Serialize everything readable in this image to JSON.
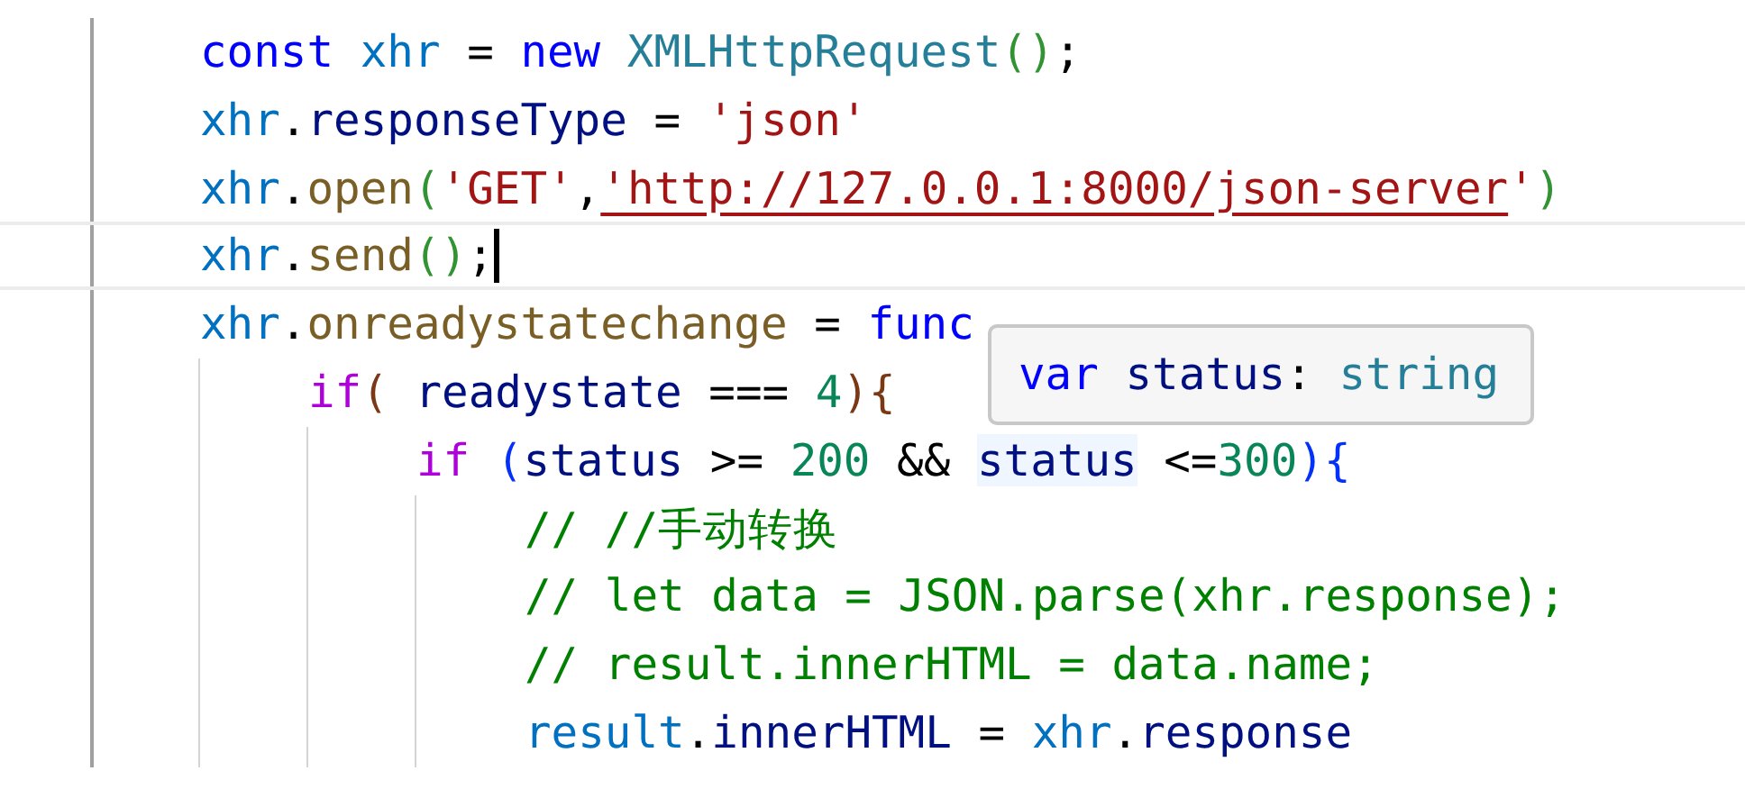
{
  "code_lines": [
    {
      "current": false,
      "tokens": [
        {
          "kind": "keyword",
          "text": "const "
        },
        {
          "kind": "variable",
          "text": "xhr"
        },
        {
          "kind": "plain",
          "text": " = "
        },
        {
          "kind": "keyword",
          "text": "new "
        },
        {
          "kind": "class",
          "text": "XMLHttpRequest"
        },
        {
          "kind": "bracket-green",
          "text": "()"
        },
        {
          "kind": "plain",
          "text": ";"
        }
      ]
    },
    {
      "current": false,
      "tokens": [
        {
          "kind": "variable",
          "text": "xhr"
        },
        {
          "kind": "plain",
          "text": "."
        },
        {
          "kind": "property",
          "text": "responseType"
        },
        {
          "kind": "plain",
          "text": " = "
        },
        {
          "kind": "string",
          "text": "'json'"
        }
      ]
    },
    {
      "current": false,
      "tokens": [
        {
          "kind": "variable",
          "text": "xhr"
        },
        {
          "kind": "plain",
          "text": "."
        },
        {
          "kind": "function",
          "text": "open"
        },
        {
          "kind": "bracket-green",
          "text": "("
        },
        {
          "kind": "string",
          "text": "'GET'"
        },
        {
          "kind": "plain",
          "text": ","
        },
        {
          "kind": "string-link",
          "text": "'http://127.0.0.1:8000/json-server"
        },
        {
          "kind": "string",
          "text": "'"
        },
        {
          "kind": "bracket-green",
          "text": ")"
        }
      ]
    },
    {
      "current": true,
      "tokens": [
        {
          "kind": "variable",
          "text": "xhr"
        },
        {
          "kind": "plain",
          "text": "."
        },
        {
          "kind": "function",
          "text": "send"
        },
        {
          "kind": "bracket-green",
          "text": "()"
        },
        {
          "kind": "plain",
          "text": ";"
        }
      ]
    },
    {
      "current": false,
      "tokens": [
        {
          "kind": "variable",
          "text": "xhr"
        },
        {
          "kind": "plain",
          "text": "."
        },
        {
          "kind": "function",
          "text": "onreadystatechange"
        },
        {
          "kind": "plain",
          "text": " = "
        },
        {
          "kind": "keyword",
          "text": "func"
        }
      ],
      "children": [
        {
          "current": false,
          "tokens": [
            {
              "kind": "control",
              "text": "if"
            },
            {
              "kind": "bracket-brown",
              "text": "( "
            },
            {
              "kind": "property",
              "text": "readystate"
            },
            {
              "kind": "plain",
              "text": " === "
            },
            {
              "kind": "number",
              "text": "4"
            },
            {
              "kind": "bracket-brown",
              "text": "){"
            }
          ],
          "children": [
            {
              "current": false,
              "tokens": [
                {
                  "kind": "control",
                  "text": "if "
                },
                {
                  "kind": "bracket-blue",
                  "text": "("
                },
                {
                  "kind": "property",
                  "text": "status"
                },
                {
                  "kind": "plain",
                  "text": " >= "
                },
                {
                  "kind": "number",
                  "text": "200"
                },
                {
                  "kind": "plain",
                  "text": " && "
                },
                {
                  "kind": "property-hover",
                  "text": "status"
                },
                {
                  "kind": "plain",
                  "text": " <="
                },
                {
                  "kind": "number",
                  "text": "300"
                },
                {
                  "kind": "bracket-blue",
                  "text": "){"
                }
              ],
              "children": [
                {
                  "current": false,
                  "tokens": [
                    {
                      "kind": "comment",
                      "text": "// //手动转换"
                    }
                  ]
                },
                {
                  "current": false,
                  "tokens": [
                    {
                      "kind": "comment",
                      "text": "// let data = JSON.parse(xhr.response);"
                    }
                  ]
                },
                {
                  "current": false,
                  "tokens": [
                    {
                      "kind": "comment",
                      "text": "// result.innerHTML = data.name;"
                    }
                  ]
                },
                {
                  "current": false,
                  "tokens": [
                    {
                      "kind": "variable",
                      "text": "result"
                    },
                    {
                      "kind": "plain",
                      "text": "."
                    },
                    {
                      "kind": "property",
                      "text": "innerHTML"
                    },
                    {
                      "kind": "plain",
                      "text": " = "
                    },
                    {
                      "kind": "variable",
                      "text": "xhr"
                    },
                    {
                      "kind": "plain",
                      "text": "."
                    },
                    {
                      "kind": "property",
                      "text": "response"
                    }
                  ]
                }
              ]
            }
          ]
        }
      ]
    }
  ],
  "hover_tooltip": {
    "tokens": [
      {
        "kind": "keyword",
        "text": "var "
      },
      {
        "kind": "property",
        "text": "status"
      },
      {
        "kind": "plain",
        "text": ": "
      },
      {
        "kind": "class",
        "text": "string"
      }
    ]
  }
}
